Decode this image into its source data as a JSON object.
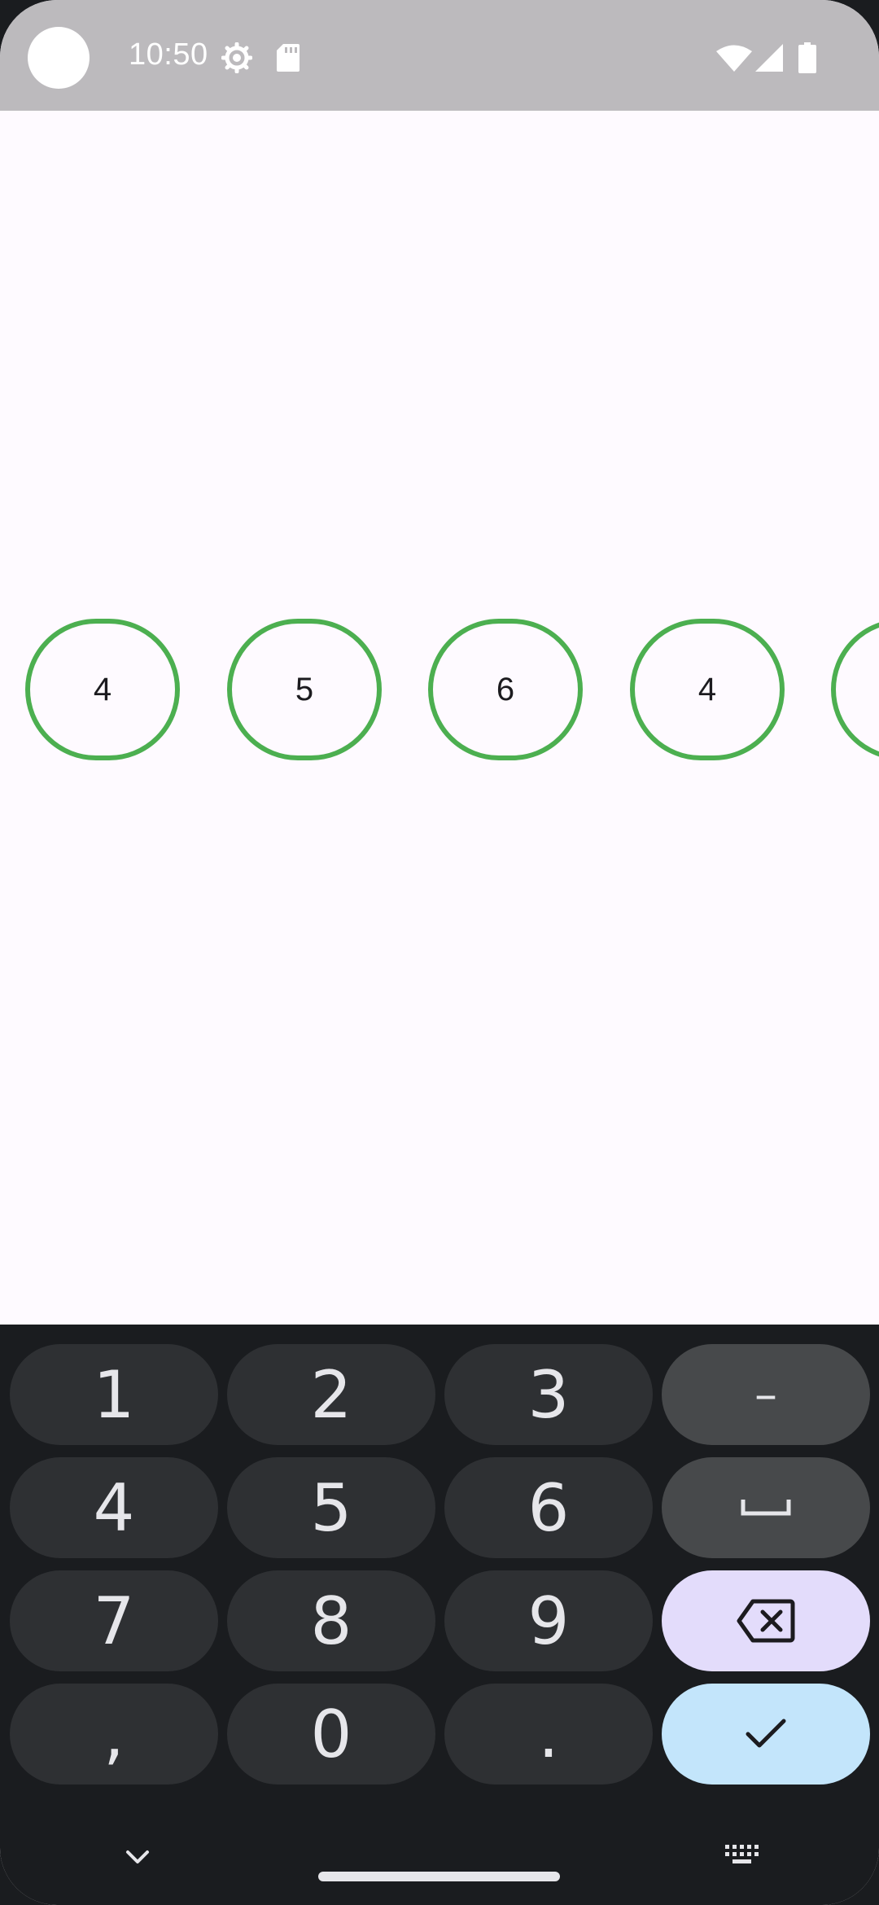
{
  "status_bar": {
    "time": "10:50",
    "icons": [
      "settings-gear-icon",
      "sd-card-icon",
      "wifi-icon",
      "cell-signal-icon",
      "battery-icon"
    ]
  },
  "bubbles": [
    "4",
    "5",
    "6",
    "4",
    ""
  ],
  "keyboard": {
    "rows": [
      [
        "1",
        "2",
        "3",
        "–"
      ],
      [
        "4",
        "5",
        "6",
        "space"
      ],
      [
        "7",
        "8",
        "9",
        "backspace"
      ],
      [
        ",",
        "0",
        ".",
        "done"
      ]
    ],
    "keys": {
      "k1": "1",
      "k2": "2",
      "k3": "3",
      "dash": "–",
      "k4": "4",
      "k5": "5",
      "k6": "6",
      "k7": "7",
      "k8": "8",
      "k9": "9",
      "comma": ",",
      "k0": "0",
      "period": "."
    },
    "icons": [
      "space-icon",
      "backspace-icon",
      "checkmark-icon",
      "chevron-down-icon",
      "keyboard-icon"
    ]
  },
  "colors": {
    "bubble_border": "#4caf50",
    "background": "#fefaff",
    "status_bar": "#bcbabd",
    "keyboard_bg": "#1a1c1f",
    "key": "#2e3033",
    "function_key": "#47494b",
    "backspace_key": "#e3dcfb",
    "done_key": "#c3e5fb"
  }
}
